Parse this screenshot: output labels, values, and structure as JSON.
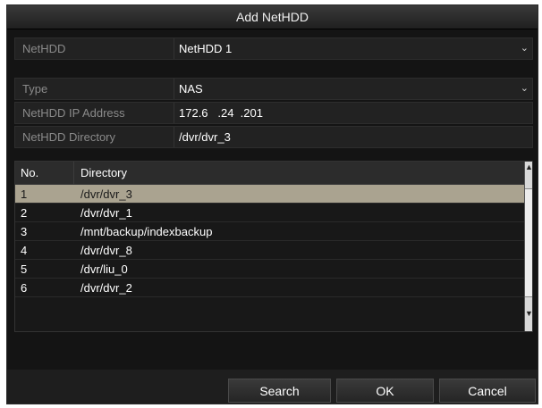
{
  "dialog": {
    "title": "Add NetHDD"
  },
  "fields": {
    "nethdd": {
      "label": "NetHDD",
      "value": "NetHDD 1"
    },
    "type": {
      "label": "Type",
      "value": "NAS"
    },
    "ip": {
      "label": "NetHDD IP Address",
      "value": "172.6   .24  .201"
    },
    "directory": {
      "label": "NetHDD Directory",
      "value": "/dvr/dvr_3"
    }
  },
  "table": {
    "headers": {
      "no": "No.",
      "directory": "Directory"
    },
    "rows": [
      {
        "no": "1",
        "directory": "/dvr/dvr_3",
        "selected": true
      },
      {
        "no": "2",
        "directory": "/dvr/dvr_1"
      },
      {
        "no": "3",
        "directory": "/mnt/backup/indexbackup"
      },
      {
        "no": "4",
        "directory": "/dvr/dvr_8"
      },
      {
        "no": "5",
        "directory": "/dvr/liu_0"
      },
      {
        "no": "6",
        "directory": "/dvr/dvr_2"
      }
    ]
  },
  "buttons": {
    "search": "Search",
    "ok": "OK",
    "cancel": "Cancel"
  },
  "icons": {
    "dropdown": "chevron-down-icon",
    "scroll_up": "scroll-up-icon",
    "scroll_down": "scroll-down-icon"
  }
}
